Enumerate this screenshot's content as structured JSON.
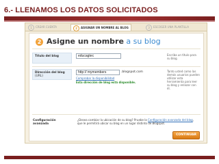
{
  "slide": {
    "heading": "6.- LLENAMOS LOS DATOS SOLICITADOS"
  },
  "steps": [
    {
      "num": "1",
      "label": "CREAR CUENTA"
    },
    {
      "num": "2",
      "label": "ASIGNAR UN NOMBRE AL BLOG"
    },
    {
      "num": "3",
      "label": "ESCOGER UNA PLANTILLA"
    }
  ],
  "panel": {
    "step_number": "2",
    "title_bold": "Asigne un nombre",
    "title_normal": " a su blog"
  },
  "blog_title": {
    "label": "Título del blog",
    "value": "educagtec",
    "help": "Escriba un título para su blog."
  },
  "blog_address": {
    "label": "Dirección del blog",
    "label_sub": "(URL)",
    "value": "http:// mymembers",
    "suffix": ".blogspot.com",
    "check_link": "Comprobar la disponibilidad",
    "availability": "Esta dirección de blog está disponible.",
    "help": "Tanto usted como las demás usuarios pueden utilizar esta herramienta para leer su blog y enlazar con él."
  },
  "advanced": {
    "label": "Configuración avanzada",
    "text_before": "¿Desea cambiar la ubicación de su blog? Pruebe la ",
    "link": "Configuración avanzada del blog",
    "text_after": ", que le permitirá ubicar su blog en un lugar distinto de Blogspot."
  },
  "continue_button": "CONTINUAR"
}
